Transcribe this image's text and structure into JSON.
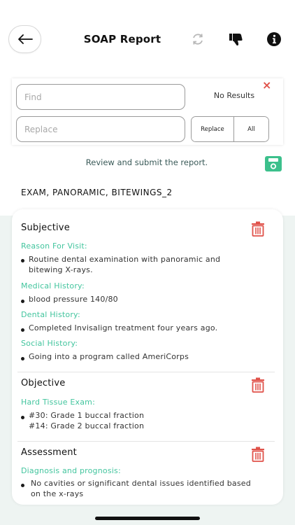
{
  "header": {
    "title": "SOAP Report"
  },
  "find_replace": {
    "find_placeholder": "Find",
    "replace_placeholder": "Replace",
    "status": "No Results",
    "close": "×",
    "replace_button": "Replace",
    "all_button": "All"
  },
  "review_prompt": "Review and submit the report.",
  "report_name": "EXAM, PANORAMIC, BITEWINGS_2",
  "sections": {
    "subjective": {
      "title": "Subjective",
      "reason_label": "Reason For Visit:",
      "reason_line1": "Routine dental examination with panoramic and",
      "reason_line2": "bitewing X-rays.",
      "medical_label": "Medical History:",
      "medical_value": "blood pressure 140/80",
      "dental_label": "Dental History:",
      "dental_value": "Completed Invisalign treatment four years ago.",
      "social_label": "Social History:",
      "social_value": "Going into a program called AmeriCorps"
    },
    "objective": {
      "title": "Objective",
      "hard_tissue_label": "Hard Tissue Exam:",
      "line1": "#30: Grade 1 buccal fraction",
      "line2": "#14: Grade 2 buccal fraction"
    },
    "assessment": {
      "title": "Assessment",
      "diagnosis_label": "Diagnosis and prognosis:",
      "line1": "No cavities or significant dental issues identified based",
      "line2": "on the x-rays"
    }
  },
  "colors": {
    "accent_green": "#43c59e",
    "delete_red": "#e0524a",
    "save_green": "#3cc08c"
  }
}
